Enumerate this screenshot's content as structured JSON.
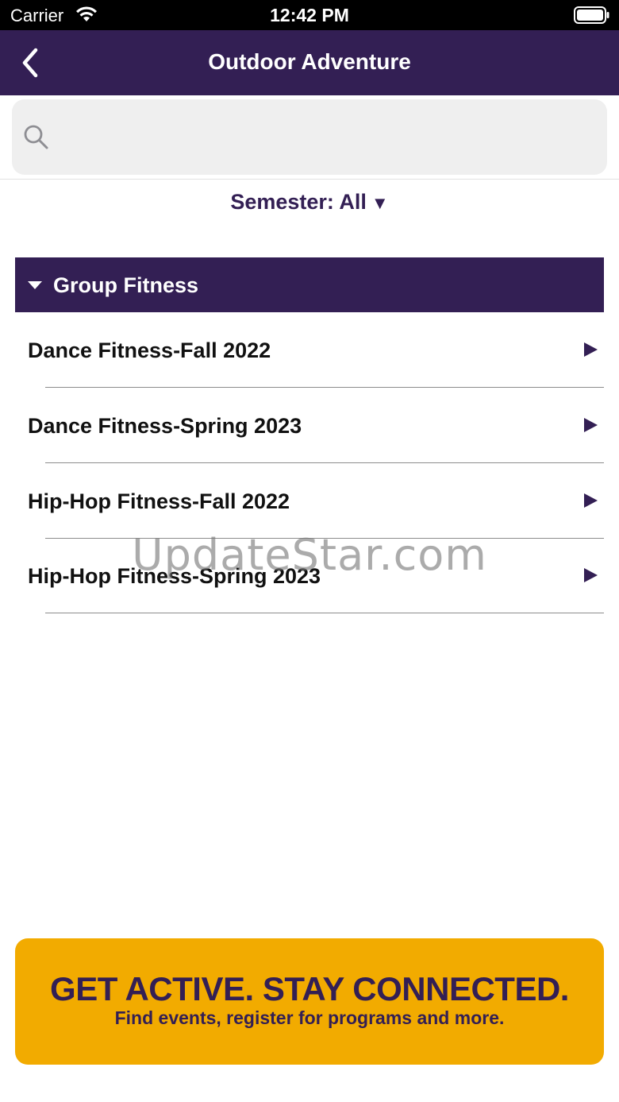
{
  "status_bar": {
    "carrier": "Carrier",
    "time": "12:42 PM"
  },
  "nav": {
    "title": "Outdoor Adventure",
    "back_icon": "chevron-left-icon"
  },
  "search": {
    "placeholder": "",
    "value": "",
    "icon": "search-icon"
  },
  "filter": {
    "label": "Semester: All",
    "caret": "▼"
  },
  "section": {
    "title": "Group Fitness",
    "expanded": true,
    "items": [
      {
        "label": "Dance Fitness-Fall 2022"
      },
      {
        "label": "Dance Fitness-Spring 2023"
      },
      {
        "label": "Hip-Hop Fitness-Fall 2022"
      },
      {
        "label": "Hip-Hop Fitness-Spring 2023"
      }
    ]
  },
  "watermark": "UpdateStar.com",
  "banner": {
    "headline": "GET ACTIVE.  STAY CONNECTED.",
    "subline": "Find events, register for programs and more."
  },
  "colors": {
    "brand_purple": "#331f54",
    "banner_gold": "#f2ab00",
    "search_bg": "#efefef"
  }
}
